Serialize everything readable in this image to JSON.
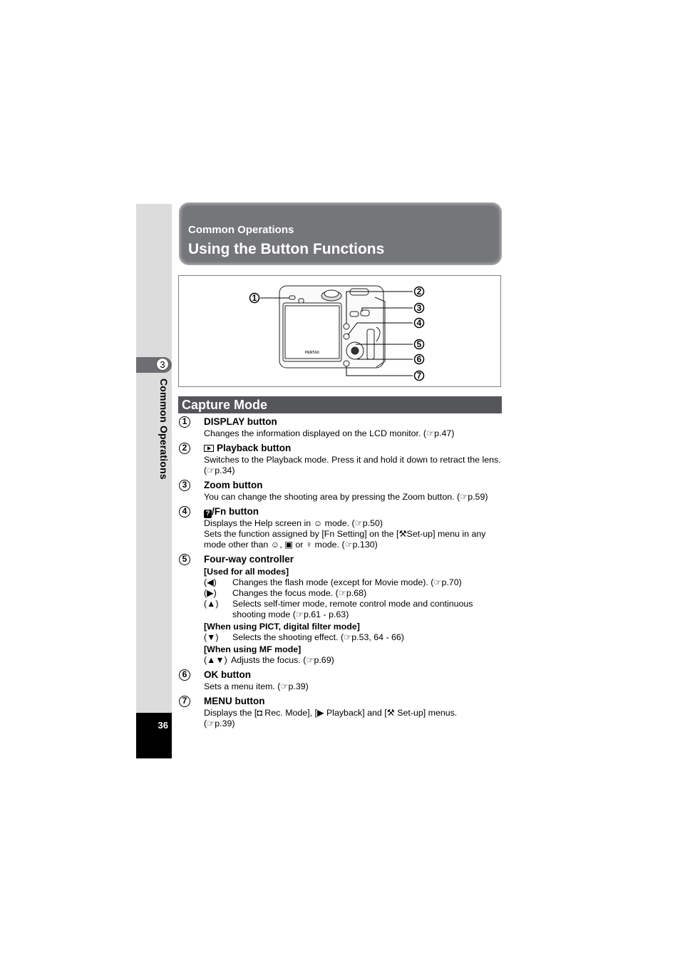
{
  "sidebar": {
    "chapter_number": "3",
    "chapter_label": "Common Operations",
    "page_number": "36"
  },
  "header": {
    "subtitle": "Common Operations",
    "title": "Using the Button Functions"
  },
  "figure": {
    "brand_label": "PENTAX",
    "callouts": [
      "1",
      "2",
      "3",
      "4",
      "5",
      "6",
      "7"
    ]
  },
  "section": {
    "title": "Capture Mode"
  },
  "items": [
    {
      "num": "1",
      "heading": "DISPLAY button",
      "lines": [
        "Changes the information displayed on the LCD monitor. (☞p.47)"
      ]
    },
    {
      "num": "2",
      "icon": "playback-icon",
      "heading": "Playback button",
      "lines": [
        "Switches to the Playback mode. Press it and hold it down to retract the lens.",
        "(☞p.34)"
      ]
    },
    {
      "num": "3",
      "heading": "Zoom button",
      "lines": [
        "You can change the shooting area by pressing the Zoom button. (☞p.59)"
      ]
    },
    {
      "num": "4",
      "icon": "help-icon",
      "icon_text": "?",
      "heading": "/Fn button",
      "lines": [
        "Displays the Help screen in ☺ mode. (☞p.50)",
        "Sets the function assigned by [Fn Setting] on the [⚒Set-up] menu in any",
        "mode other than ☺, ▣ or ♀ mode. (☞p.130)"
      ]
    },
    {
      "num": "5",
      "heading": "Four-way controller",
      "groups": [
        {
          "subheading": "[Used for all modes]",
          "rows": [
            {
              "key": "(◀)",
              "text": "Changes the flash mode (except for Movie mode). (☞p.70)"
            },
            {
              "key": "(▶)",
              "text": "Changes the focus mode. (☞p.68)"
            },
            {
              "key": "(▲)",
              "text": "Selects self-timer mode, remote control mode and continuous shooting mode (☞p.61 - p.63)"
            }
          ]
        },
        {
          "subheading": "[When using PICT, digital filter mode]",
          "rows": [
            {
              "key": "(▼)",
              "text": "Selects the shooting effect. (☞p.53, 64 - 66)"
            }
          ]
        },
        {
          "subheading": "[When using MF mode]",
          "rows": [
            {
              "key": "(▲▼)",
              "text": "Adjusts the focus. (☞p.69)"
            }
          ]
        }
      ]
    },
    {
      "num": "6",
      "heading": "OK button",
      "lines": [
        "Sets a menu item. (☞p.39)"
      ]
    },
    {
      "num": "7",
      "heading": "MENU button",
      "lines": [
        "Displays the [◘ Rec. Mode], [▶ Playback] and [⚒ Set-up] menus.",
        "(☞p.39)"
      ]
    }
  ]
}
